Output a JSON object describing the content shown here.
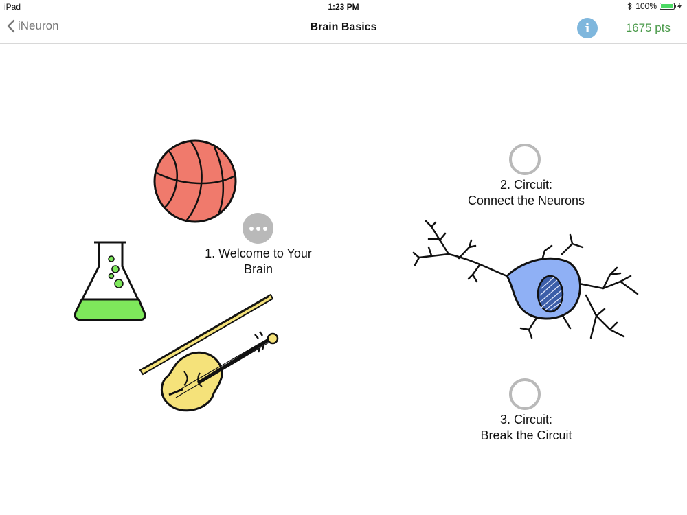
{
  "status_bar": {
    "device": "iPad",
    "time": "1:23 PM",
    "battery": "100%",
    "battery_level": 1.0
  },
  "nav": {
    "back_label": "iNeuron",
    "title": "Brain Basics",
    "info_label": "i",
    "points": "1675 pts"
  },
  "lessons": [
    {
      "number_line": "1. Welcome to Your",
      "name_line": "Brain",
      "state": "in-progress"
    },
    {
      "number_line": "2. Circuit:",
      "name_line": "Connect the Neurons",
      "state": "not-started"
    },
    {
      "number_line": "3. Circuit:",
      "name_line": "Break the Circuit",
      "state": "not-started"
    }
  ],
  "colors": {
    "points": "#4a9a4a",
    "info": "#7fb7dd",
    "basketball": "#f07a6c",
    "flask_liquid": "#7ee85b",
    "violin": "#f5e27a",
    "neuron_body": "#8fb0f5",
    "status_ring": "#b9b9b9"
  },
  "icons": [
    "back-chevron-icon",
    "bluetooth-icon",
    "battery-icon",
    "info-icon",
    "more-icon"
  ]
}
